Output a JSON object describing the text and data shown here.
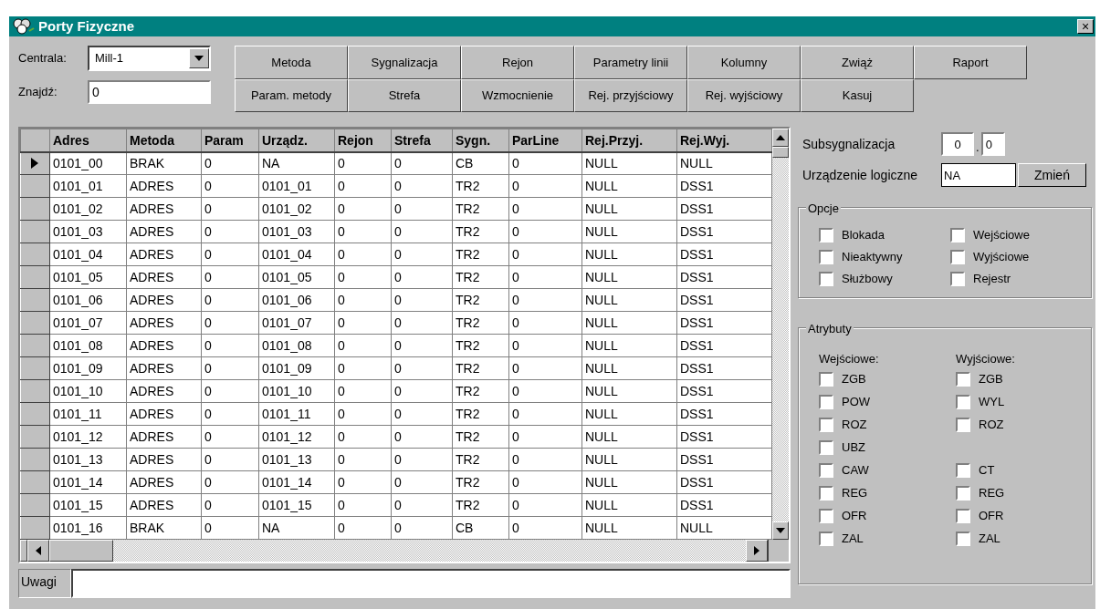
{
  "window": {
    "title": "Porty Fizyczne",
    "close": "×"
  },
  "centrala": {
    "label": "Centrala:",
    "value": "Mill-1"
  },
  "find": {
    "label": "Znajdź:",
    "value": "0"
  },
  "buttons": [
    [
      {
        "label": "Metoda"
      },
      {
        "label": "Sygnalizacja"
      },
      {
        "label": "Rejon"
      },
      {
        "label": "Parametry linii"
      },
      {
        "label": "Kolumny"
      },
      {
        "label": "Zwiąż"
      },
      {
        "label": "Raport"
      }
    ],
    [
      {
        "label": "Param. metody"
      },
      {
        "label": "Strefa"
      },
      {
        "label": "Wzmocnienie"
      },
      {
        "label": "Rej. przyjściowy"
      },
      {
        "label": "Rej. wyjściowy"
      },
      {
        "label": "Kasuj"
      }
    ]
  ],
  "table": {
    "columns": [
      "Adres",
      "Metoda",
      "Param",
      "Urządz.",
      "Rejon",
      "Strefa",
      "Sygn.",
      "ParLine",
      "Rej.Przyj.",
      "Rej.Wyj."
    ],
    "rows": [
      {
        "selected": true,
        "cells": [
          "0101_00",
          "BRAK",
          "0",
          "NA",
          "0",
          "0",
          "CB",
          "0",
          "NULL",
          "NULL"
        ]
      },
      {
        "selected": false,
        "cells": [
          "0101_01",
          "ADRES",
          "0",
          "0101_01",
          "0",
          "0",
          "TR2",
          "0",
          "NULL",
          "DSS1"
        ]
      },
      {
        "selected": false,
        "cells": [
          "0101_02",
          "ADRES",
          "0",
          "0101_02",
          "0",
          "0",
          "TR2",
          "0",
          "NULL",
          "DSS1"
        ]
      },
      {
        "selected": false,
        "cells": [
          "0101_03",
          "ADRES",
          "0",
          "0101_03",
          "0",
          "0",
          "TR2",
          "0",
          "NULL",
          "DSS1"
        ]
      },
      {
        "selected": false,
        "cells": [
          "0101_04",
          "ADRES",
          "0",
          "0101_04",
          "0",
          "0",
          "TR2",
          "0",
          "NULL",
          "DSS1"
        ]
      },
      {
        "selected": false,
        "cells": [
          "0101_05",
          "ADRES",
          "0",
          "0101_05",
          "0",
          "0",
          "TR2",
          "0",
          "NULL",
          "DSS1"
        ]
      },
      {
        "selected": false,
        "cells": [
          "0101_06",
          "ADRES",
          "0",
          "0101_06",
          "0",
          "0",
          "TR2",
          "0",
          "NULL",
          "DSS1"
        ]
      },
      {
        "selected": false,
        "cells": [
          "0101_07",
          "ADRES",
          "0",
          "0101_07",
          "0",
          "0",
          "TR2",
          "0",
          "NULL",
          "DSS1"
        ]
      },
      {
        "selected": false,
        "cells": [
          "0101_08",
          "ADRES",
          "0",
          "0101_08",
          "0",
          "0",
          "TR2",
          "0",
          "NULL",
          "DSS1"
        ]
      },
      {
        "selected": false,
        "cells": [
          "0101_09",
          "ADRES",
          "0",
          "0101_09",
          "0",
          "0",
          "TR2",
          "0",
          "NULL",
          "DSS1"
        ]
      },
      {
        "selected": false,
        "cells": [
          "0101_10",
          "ADRES",
          "0",
          "0101_10",
          "0",
          "0",
          "TR2",
          "0",
          "NULL",
          "DSS1"
        ]
      },
      {
        "selected": false,
        "cells": [
          "0101_11",
          "ADRES",
          "0",
          "0101_11",
          "0",
          "0",
          "TR2",
          "0",
          "NULL",
          "DSS1"
        ]
      },
      {
        "selected": false,
        "cells": [
          "0101_12",
          "ADRES",
          "0",
          "0101_12",
          "0",
          "0",
          "TR2",
          "0",
          "NULL",
          "DSS1"
        ]
      },
      {
        "selected": false,
        "cells": [
          "0101_13",
          "ADRES",
          "0",
          "0101_13",
          "0",
          "0",
          "TR2",
          "0",
          "NULL",
          "DSS1"
        ]
      },
      {
        "selected": false,
        "cells": [
          "0101_14",
          "ADRES",
          "0",
          "0101_14",
          "0",
          "0",
          "TR2",
          "0",
          "NULL",
          "DSS1"
        ]
      },
      {
        "selected": false,
        "cells": [
          "0101_15",
          "ADRES",
          "0",
          "0101_15",
          "0",
          "0",
          "TR2",
          "0",
          "NULL",
          "DSS1"
        ]
      },
      {
        "selected": false,
        "cells": [
          "0101_16",
          "BRAK",
          "0",
          "NA",
          "0",
          "0",
          "CB",
          "0",
          "NULL",
          "NULL"
        ]
      }
    ]
  },
  "notes": {
    "label": "Uwagi"
  },
  "subsignal": {
    "label": "Subsygnalizacja",
    "value_1": "0",
    "separator": ".",
    "value_2": "0"
  },
  "logical_device": {
    "label": "Urządzenie logiczne",
    "value": "NA",
    "button": "Zmień"
  },
  "options": {
    "title": "Opcje",
    "columns": [
      [
        {
          "label": "Blokada",
          "checked": false
        },
        {
          "label": "Nieaktywny",
          "checked": false
        },
        {
          "label": "Służbowy",
          "checked": false
        }
      ],
      [
        {
          "label": "Wejściowe",
          "checked": false
        },
        {
          "label": "Wyjściowe",
          "checked": false
        },
        {
          "label": "Rejestr",
          "checked": false
        }
      ]
    ]
  },
  "attributes": {
    "title": "Atrybuty",
    "input_heading": "Wejściowe:",
    "output_heading": "Wyjściowe:",
    "rows": [
      {
        "input": {
          "label": "ZGB",
          "checked": false
        },
        "output": {
          "label": "ZGB",
          "checked": false
        }
      },
      {
        "input": {
          "label": "POW",
          "checked": false
        },
        "output": {
          "label": "WYL",
          "checked": false
        }
      },
      {
        "input": {
          "label": "ROZ",
          "checked": false
        },
        "output": {
          "label": "ROZ",
          "checked": false
        }
      },
      {
        "input": {
          "label": "UBZ",
          "checked": false
        }
      },
      {
        "input": {
          "label": "CAW",
          "checked": false
        },
        "output": {
          "label": "CT",
          "checked": false
        }
      },
      {
        "input": {
          "label": "REG",
          "checked": false
        },
        "output": {
          "label": "REG",
          "checked": false
        }
      },
      {
        "input": {
          "label": "OFR",
          "checked": false
        },
        "output": {
          "label": "OFR",
          "checked": false
        }
      },
      {
        "input": {
          "label": "ZAL",
          "checked": false
        },
        "output": {
          "label": "ZAL",
          "checked": false
        }
      }
    ]
  }
}
